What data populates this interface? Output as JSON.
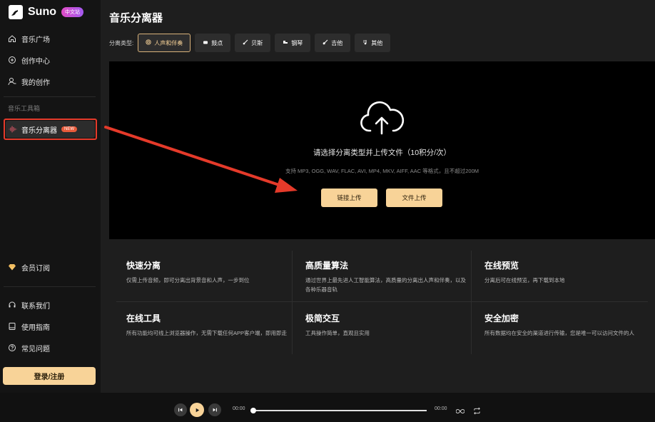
{
  "app": {
    "name": "Suno",
    "badge": "中文站"
  },
  "sidebar": {
    "nav": [
      {
        "label": "音乐广场",
        "icon": "home-icon"
      },
      {
        "label": "创作中心",
        "icon": "create-icon"
      },
      {
        "label": "我的创作",
        "icon": "user-icon"
      }
    ],
    "section_label": "音乐工具箱",
    "active_item": {
      "label": "音乐分离器",
      "badge": "NEW",
      "icon": "waveform-icon"
    },
    "membership": {
      "label": "会员订阅",
      "icon": "diamond-icon"
    },
    "bottom": [
      {
        "label": "联系我们",
        "icon": "headset-icon"
      },
      {
        "label": "使用指南",
        "icon": "book-icon"
      },
      {
        "label": "常见问题",
        "icon": "help-icon"
      }
    ],
    "login_label": "登录/注册"
  },
  "main": {
    "title": "音乐分离器",
    "separation_label": "分离类型:",
    "tabs": [
      {
        "label": "人声和伴奏",
        "icon": "vocal-icon",
        "active": true
      },
      {
        "label": "鼓点",
        "icon": "drum-icon",
        "active": false
      },
      {
        "label": "贝斯",
        "icon": "bass-icon",
        "active": false
      },
      {
        "label": "钢琴",
        "icon": "piano-icon",
        "active": false
      },
      {
        "label": "吉他",
        "icon": "guitar-icon",
        "active": false
      },
      {
        "label": "其他",
        "icon": "other-icon",
        "active": false
      }
    ],
    "upload": {
      "main_text": "请选择分离类型并上传文件（10积分/次）",
      "sub_text": "支持 MP3, OGG, WAV, FLAC, AVI, MP4, MKV, AIFF, AAC 等格式，且不超过200M",
      "link_button": "链接上传",
      "file_button": "文件上传"
    },
    "features": [
      {
        "title": "快速分离",
        "desc": "仅需上传音频，即可分离出背景音和人声，一步到位"
      },
      {
        "title": "高质量算法",
        "desc": "通过世界上最先进人工智能算法，高质量的分离出人声和伴奏，以及各种乐器音轨"
      },
      {
        "title": "在线预览",
        "desc": "分离后可在线预览，再下载到本地"
      },
      {
        "title": "在线工具",
        "desc": "所有功能均可线上浏览器操作，无需下载任何APP客户端，即用即走"
      },
      {
        "title": "极简交互",
        "desc": "工具操作简单，直观且实用"
      },
      {
        "title": "安全加密",
        "desc": "所有数据均在安全的渠道进行传输，您是唯一可以访问文件的人"
      }
    ]
  },
  "player": {
    "current_time": "00:00",
    "total_time": "00:00",
    "progress": 0
  },
  "colors": {
    "accent": "#f8d398",
    "annotation": "#e53a2a"
  }
}
